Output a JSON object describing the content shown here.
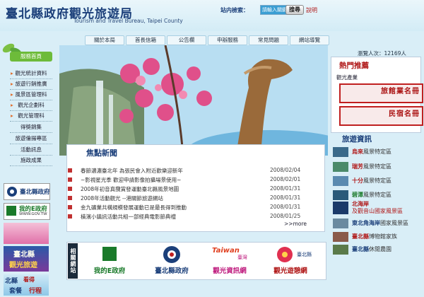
{
  "header": {
    "title_zh": "臺北縣政府觀光旅遊局",
    "title_en": "Tourism and Travel Bureau, Taipei County",
    "search_label": "站内檢索：",
    "search_value": "請輸入關鍵字",
    "search_button": "搜尋",
    "help_link": "說明"
  },
  "nav": [
    "關於本局",
    "首長信箱",
    "公告欄",
    "申辦服務",
    "常見問題",
    "網站導覽"
  ],
  "visitor": "瀏覽人次：12169人",
  "sidebar": {
    "header": "服務首頁",
    "items": [
      "觀光統計資料",
      "旅遊行銷推廣",
      "風景區管理科",
      "觀光企劃科",
      "觀光管理科",
      "得獎錦集",
      "旅遊倫揚專區",
      "活動訊息",
      "施政成果"
    ]
  },
  "left_banners": {
    "county_gov": "臺北縣政府",
    "egov": "我的E政府",
    "egov_url": "WWW.GOV.TW",
    "taipei_tour_line1": "臺北縣",
    "taipei_tour_line2": "觀光旅遊",
    "north_line1": "北縣",
    "north_line2": "看得",
    "north_line3": "套餐",
    "north_line4": "行程"
  },
  "news": {
    "title": "焦點新聞",
    "items": [
      {
        "text": "春節濃濃臺北年 為張民會入附近歡樂迎新年",
        "date": "2008/02/04"
      },
      {
        "text": "~影視星光季 歡迎申請影像拍攝場景使用~",
        "date": "2008/02/01"
      },
      {
        "text": "2008年初音真攬賞發運動臺北縣風景地圖",
        "date": "2008/01/31"
      },
      {
        "text": "2008年活動觀光 --港關節旅遊網站",
        "date": "2008/01/31"
      },
      {
        "text": "金九礦業共構規模發展運動已是最長得到推動",
        "date": "2008/01/31"
      },
      {
        "text": "橫濱小鎮訊活動共組一部經典電影節典禮",
        "date": "2008/01/25"
      }
    ],
    "more": ">>more"
  },
  "related": {
    "label": "相關網站",
    "items": [
      {
        "name": "我的E政府",
        "color": "#1a7a2a"
      },
      {
        "name": "臺北縣政府",
        "color": "#1b3f7a"
      },
      {
        "name": "觀光資訊網",
        "color": "#c02080"
      },
      {
        "name": "觀光遊憩網",
        "color": "#b01818"
      }
    ],
    "tourism_logo": "Taiwan",
    "tourism_sub": "臺灣",
    "recreation_small": "臺北縣"
  },
  "hot": {
    "title": "熱門推薦",
    "subtitle": "觀光產業",
    "hotel": "旅館業名冊",
    "bnb": "民宿名冊"
  },
  "travel": {
    "title": "旅遊資訊",
    "items": [
      {
        "hl": "烏來",
        "rest": "風景特定區",
        "hl_color": "#b01818"
      },
      {
        "hl": "瑞芳",
        "rest": "風景特定區",
        "hl_color": "#b01818"
      },
      {
        "hl": "十分",
        "rest": "風景特定區",
        "hl_color": "#b01818"
      },
      {
        "hl": "碧潭",
        "rest": "風景特定區",
        "hl_color": "#1a7a2a"
      },
      {
        "hl": "北海岸",
        "rest": "及觀音山國家風景區",
        "hl_color": "#b01818"
      },
      {
        "hl": "東北角海岸",
        "rest": "國家風景區",
        "hl_color": "#1b3f7a"
      },
      {
        "hl": "臺北縣",
        "rest": "博物館家族",
        "hl_color": "#b01818"
      },
      {
        "hl": "臺北縣",
        "rest": "休閒農園",
        "hl_color": "#1b3f7a"
      }
    ]
  }
}
